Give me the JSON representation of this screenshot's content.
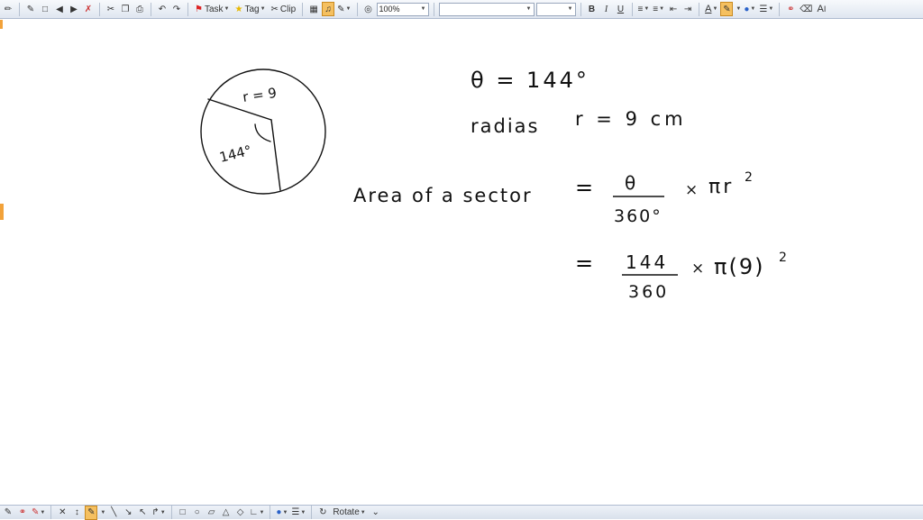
{
  "toolbar": {
    "task_label": "Task",
    "tag_label": "Tag",
    "clip_label": "Clip",
    "zoom_value": "100%",
    "font_name": "",
    "font_size": "",
    "bold_label": "B",
    "italic_label": "I",
    "underline_label": "U",
    "text_color_label": "A",
    "font_size_label": "A"
  },
  "bottombar": {
    "rotate_label": "Rotate"
  },
  "note": {
    "diagram_radius": "r = 9",
    "diagram_angle": "144°",
    "line1": "θ = 144°",
    "line2_word": "radias",
    "line2_value": "r = 9 cm",
    "area_label": "Area of a sector",
    "equals1": "=",
    "frac1_num": "θ",
    "frac1_den": "360°",
    "times1": "×",
    "pi_r2": "πr",
    "exp1": "2",
    "equals2": "=",
    "frac2_num": "144",
    "frac2_den": "360",
    "times2": "×",
    "pi_9": "π(9)",
    "exp2": "2"
  }
}
